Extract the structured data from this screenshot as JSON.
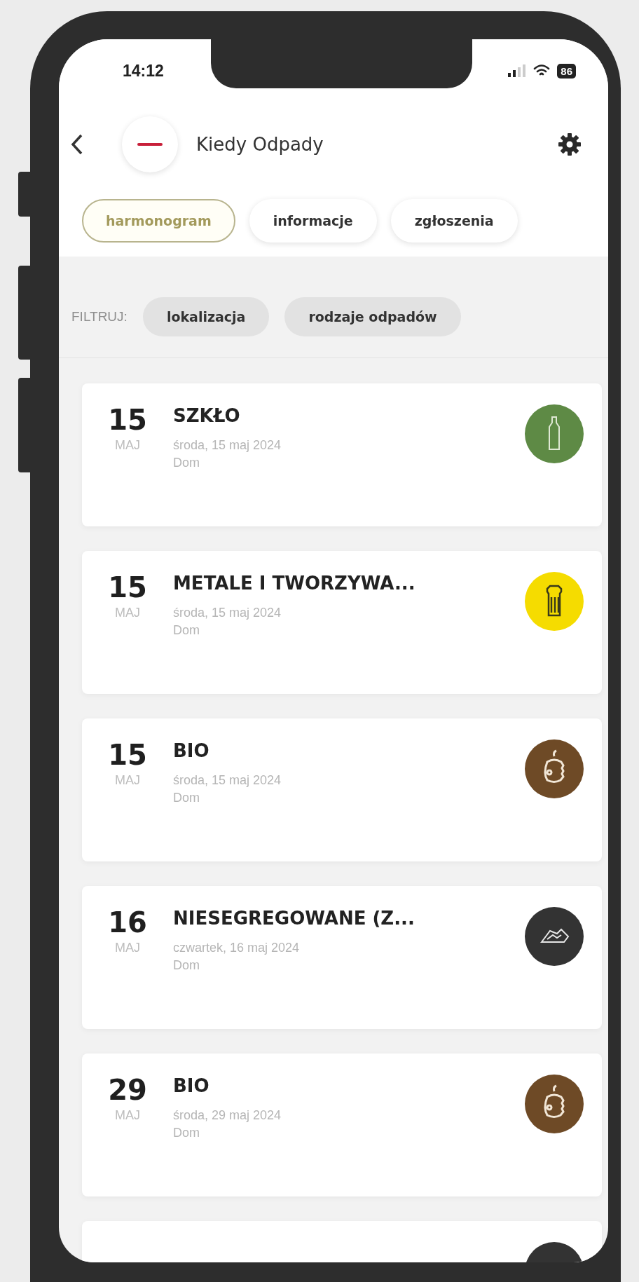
{
  "status_bar": {
    "time": "14:12",
    "battery": "86"
  },
  "header": {
    "title": "Kiedy Odpady"
  },
  "tabs": [
    {
      "label": "harmonogram",
      "selected": true
    },
    {
      "label": "informacje",
      "selected": false
    },
    {
      "label": "zgłoszenia",
      "selected": false
    }
  ],
  "filter": {
    "label": "FILTRUJ:",
    "chips": [
      "lokalizacja",
      "rodzaje odpadów"
    ]
  },
  "events": [
    {
      "day": "15",
      "month": "MAJ",
      "title": "SZKŁO",
      "date": "środa, 15 maj 2024",
      "place": "Dom",
      "kind": "glass",
      "color": "#5e8a45"
    },
    {
      "day": "15",
      "month": "MAJ",
      "title": "METALE I TWORZYWA...",
      "date": "środa, 15 maj 2024",
      "place": "Dom",
      "kind": "plastic",
      "color": "#f5dc00"
    },
    {
      "day": "15",
      "month": "MAJ",
      "title": "BIO",
      "date": "środa, 15 maj 2024",
      "place": "Dom",
      "kind": "bio",
      "color": "#6e4a26"
    },
    {
      "day": "16",
      "month": "MAJ",
      "title": "NIESEGREGOWANE (Z...",
      "date": "czwartek, 16 maj 2024",
      "place": "Dom",
      "kind": "mixed",
      "color": "#333333"
    },
    {
      "day": "29",
      "month": "MAJ",
      "title": "BIO",
      "date": "środa, 29 maj 2024",
      "place": "Dom",
      "kind": "bio",
      "color": "#6e4a26"
    },
    {
      "kind": "mixed",
      "color": "#333333"
    }
  ]
}
